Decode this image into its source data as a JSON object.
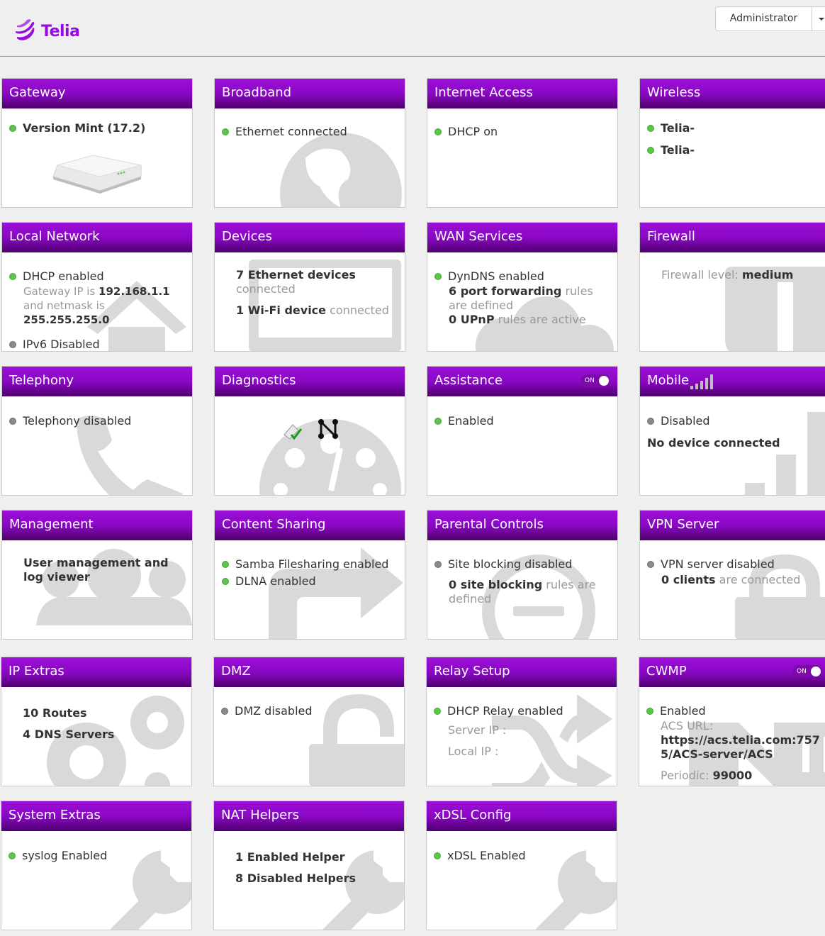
{
  "brand": {
    "name": "Telia",
    "color": "#990ae3"
  },
  "user_menu": {
    "label": "Administrator"
  },
  "cards": {
    "gateway": {
      "title": "Gateway",
      "version": "Version Mint (17.2)"
    },
    "broadband": {
      "title": "Broadband",
      "status": "Ethernet connected"
    },
    "internet": {
      "title": "Internet Access",
      "status": "DHCP on"
    },
    "wireless": {
      "title": "Wireless",
      "ssid1": "Telia-",
      "ssid2": "Telia-"
    },
    "local": {
      "title": "Local Network",
      "dhcp": "DHCP enabled",
      "gw_prefix": "Gateway IP is",
      "gw_ip": "192.168.1.1",
      "netmask_prefix": "and netmask is",
      "netmask": "255.255.255.0",
      "ipv6": "IPv6 Disabled"
    },
    "devices": {
      "title": "Devices",
      "eth_count": "7 Ethernet devices",
      "eth_suffix": "connected",
      "wifi_count": "1 Wi-Fi device",
      "wifi_suffix": "connected"
    },
    "wan": {
      "title": "WAN Services",
      "dyndns": "DynDNS enabled",
      "pf_count": "6 port forwarding",
      "pf_suffix": "rules",
      "pf_suffix2": "are defined",
      "upnp_count": "0 UPnP",
      "upnp_suffix": "rules are active"
    },
    "firewall": {
      "title": "Firewall",
      "level_label": "Firewall level:",
      "level": "medium"
    },
    "telephony": {
      "title": "Telephony",
      "status": "Telephony disabled"
    },
    "diagnostics": {
      "title": "Diagnostics"
    },
    "assistance": {
      "title": "Assistance",
      "toggle": "ON",
      "status": "Enabled"
    },
    "mobile": {
      "title": "Mobile",
      "status": "Disabled",
      "device": "No device connected"
    },
    "management": {
      "title": "Management",
      "line1": "User management and",
      "line2": "log viewer"
    },
    "sharing": {
      "title": "Content Sharing",
      "samba": "Samba Filesharing enabled",
      "dlna": "DLNA enabled"
    },
    "parental": {
      "title": "Parental Controls",
      "status": "Site blocking disabled",
      "count": "0 site blocking",
      "suffix": "rules are",
      "suffix2": "defined"
    },
    "vpn": {
      "title": "VPN Server",
      "status": "VPN server disabled",
      "count": "0 clients",
      "suffix": "are connected"
    },
    "ipextras": {
      "title": "IP Extras",
      "routes": "10 Routes",
      "dns": "4 DNS Servers"
    },
    "dmz": {
      "title": "DMZ",
      "status": "DMZ disabled"
    },
    "relay": {
      "title": "Relay Setup",
      "status": "DHCP Relay enabled",
      "server": "Server IP :",
      "local": "Local IP :"
    },
    "cwmp": {
      "title": "CWMP",
      "toggle": "ON",
      "status": "Enabled",
      "url_label": "ACS URL:",
      "url1": "https://acs.telia.com:757",
      "url2": "5/ACS-server/ACS",
      "periodic_label": "Periodic:",
      "periodic": "99000"
    },
    "sysextras": {
      "title": "System Extras",
      "status": "syslog Enabled"
    },
    "nat": {
      "title": "NAT Helpers",
      "enabled": "1 Enabled Helper",
      "disabled": "8 Disabled Helpers"
    },
    "xdsl": {
      "title": "xDSL Config",
      "status": "xDSL Enabled"
    }
  }
}
